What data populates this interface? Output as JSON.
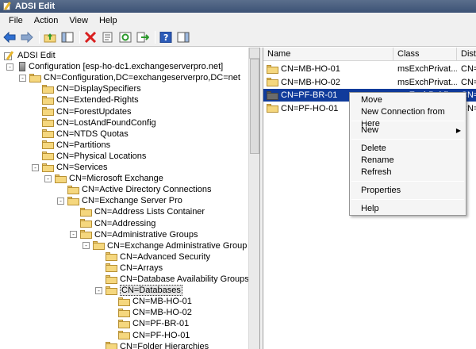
{
  "window": {
    "title": "ADSI Edit"
  },
  "menu": [
    "File",
    "Action",
    "View",
    "Help"
  ],
  "toolbar": [
    {
      "name": "back-icon"
    },
    {
      "name": "forward-icon"
    },
    {
      "name": "sep"
    },
    {
      "name": "up-folder-icon"
    },
    {
      "name": "show-hide-tree-icon"
    },
    {
      "name": "sep"
    },
    {
      "name": "delete-icon"
    },
    {
      "name": "properties-sheet-icon"
    },
    {
      "name": "refresh-icon"
    },
    {
      "name": "export-list-icon"
    },
    {
      "name": "sep"
    },
    {
      "name": "help-icon"
    },
    {
      "name": "show-hide-action-pane-icon"
    }
  ],
  "tree": [
    {
      "label": "ADSI Edit",
      "level": 0,
      "icon": "root",
      "exp": ""
    },
    {
      "label": "Configuration [esp-ho-dc1.exchangeserverpro.net]",
      "level": 0,
      "icon": "server",
      "exp": "-"
    },
    {
      "label": "CN=Configuration,DC=exchangeserverpro,DC=net",
      "level": 1,
      "icon": "folder",
      "exp": "-"
    },
    {
      "label": "CN=DisplaySpecifiers",
      "level": 2,
      "icon": "folder",
      "exp": ""
    },
    {
      "label": "CN=Extended-Rights",
      "level": 2,
      "icon": "folder",
      "exp": ""
    },
    {
      "label": "CN=ForestUpdates",
      "level": 2,
      "icon": "folder",
      "exp": ""
    },
    {
      "label": "CN=LostAndFoundConfig",
      "level": 2,
      "icon": "folder",
      "exp": ""
    },
    {
      "label": "CN=NTDS Quotas",
      "level": 2,
      "icon": "folder",
      "exp": ""
    },
    {
      "label": "CN=Partitions",
      "level": 2,
      "icon": "folder",
      "exp": ""
    },
    {
      "label": "CN=Physical Locations",
      "level": 2,
      "icon": "folder",
      "exp": ""
    },
    {
      "label": "CN=Services",
      "level": 2,
      "icon": "folder",
      "exp": "-"
    },
    {
      "label": "CN=Microsoft Exchange",
      "level": 3,
      "icon": "folder",
      "exp": "-"
    },
    {
      "label": "CN=Active Directory Connections",
      "level": 4,
      "icon": "folder",
      "exp": ""
    },
    {
      "label": "CN=Exchange Server Pro",
      "level": 4,
      "icon": "folder",
      "exp": "-"
    },
    {
      "label": "CN=Address Lists Container",
      "level": 5,
      "icon": "folder",
      "exp": ""
    },
    {
      "label": "CN=Addressing",
      "level": 5,
      "icon": "folder",
      "exp": ""
    },
    {
      "label": "CN=Administrative Groups",
      "level": 5,
      "icon": "folder",
      "exp": "-"
    },
    {
      "label": "CN=Exchange Administrative Group (FYD",
      "level": 6,
      "icon": "folder",
      "exp": "-"
    },
    {
      "label": "CN=Advanced Security",
      "level": 7,
      "icon": "folder",
      "exp": ""
    },
    {
      "label": "CN=Arrays",
      "level": 7,
      "icon": "folder",
      "exp": ""
    },
    {
      "label": "CN=Database Availability Groups",
      "level": 7,
      "icon": "folder",
      "exp": ""
    },
    {
      "label": "CN=Databases",
      "level": 7,
      "icon": "folder",
      "exp": "-",
      "selected": true
    },
    {
      "label": "CN=MB-HO-01",
      "level": 8,
      "icon": "folder",
      "exp": ""
    },
    {
      "label": "CN=MB-HO-02",
      "level": 8,
      "icon": "folder",
      "exp": ""
    },
    {
      "label": "CN=PF-BR-01",
      "level": 8,
      "icon": "folder",
      "exp": ""
    },
    {
      "label": "CN=PF-HO-01",
      "level": 8,
      "icon": "folder",
      "exp": ""
    },
    {
      "label": "CN=Folder Hierarchies",
      "level": 7,
      "icon": "folder",
      "exp": ""
    }
  ],
  "list": {
    "columns": [
      "Name",
      "Class",
      "Distin"
    ],
    "rows": [
      {
        "name": "CN=MB-HO-01",
        "class": "msExchPrivat...",
        "dn": "CN=M"
      },
      {
        "name": "CN=MB-HO-02",
        "class": "msExchPrivat...",
        "dn": "CN=M"
      },
      {
        "name": "CN=PF-BR-01",
        "class": "msExchPublic...",
        "dn": "CN=P",
        "selected": true
      },
      {
        "name": "CN=PF-HO-01",
        "class": "",
        "dn": "CN=P"
      }
    ]
  },
  "context_menu": [
    {
      "label": "Move"
    },
    {
      "label": "New Connection from Here"
    },
    {
      "sep": true
    },
    {
      "label": "New",
      "submenu": true
    },
    {
      "sep": true
    },
    {
      "label": "Delete"
    },
    {
      "label": "Rename"
    },
    {
      "label": "Refresh"
    },
    {
      "sep": true
    },
    {
      "label": "Properties"
    },
    {
      "sep": true
    },
    {
      "label": "Help"
    }
  ]
}
